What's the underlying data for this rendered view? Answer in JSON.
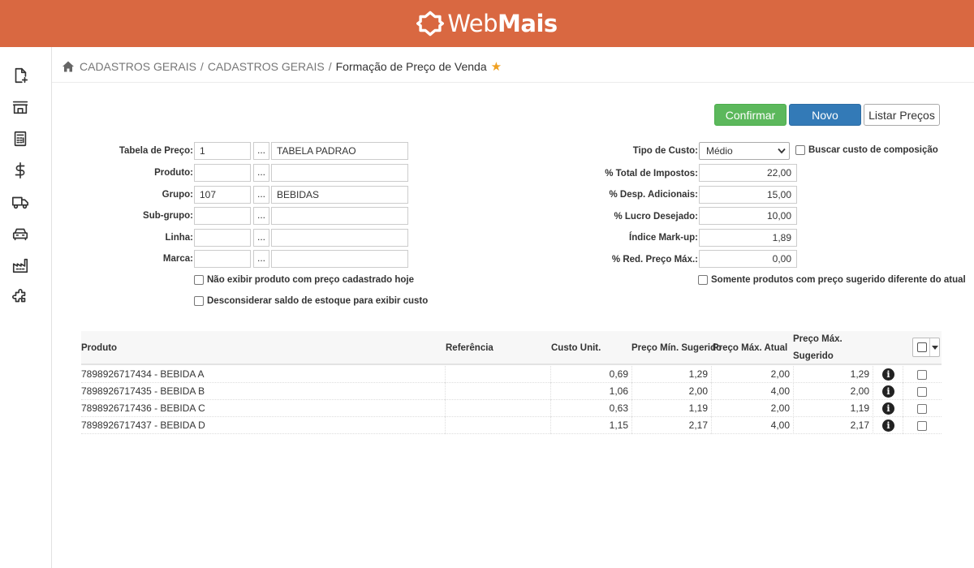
{
  "app": {
    "logo_light": "Web",
    "logo_bold": "Mais"
  },
  "breadcrumb": {
    "items": [
      "CADASTROS GERAIS",
      "CADASTROS GERAIS"
    ],
    "separator": "/",
    "current": "Formação de Preço de Venda",
    "star": "★"
  },
  "sidebar": {
    "icons": [
      "file-plus-icon",
      "store-icon",
      "calculator-icon",
      "dollar-icon",
      "truck-icon",
      "car-icon",
      "factory-icon",
      "puzzle-icon"
    ]
  },
  "buttons": {
    "confirm": "Confirmar",
    "novo": "Novo",
    "listar": "Listar Preços"
  },
  "colors": {
    "topbar": "#d96841",
    "confirm": "#5cb85c",
    "novo": "#337ab7",
    "star": "#f0a020"
  },
  "form": {
    "tabela_preco": {
      "label": "Tabela de Preço:",
      "code": "1",
      "dots": "...",
      "name": "TABELA PADRAO"
    },
    "produto": {
      "label": "Produto:",
      "code": "",
      "dots": "...",
      "name": ""
    },
    "grupo": {
      "label": "Grupo:",
      "code": "107",
      "dots": "...",
      "name": "BEBIDAS"
    },
    "subgrupo": {
      "label": "Sub-grupo:",
      "code": "",
      "dots": "...",
      "name": ""
    },
    "linha": {
      "label": "Linha:",
      "code": "",
      "dots": "...",
      "name": ""
    },
    "marca": {
      "label": "Marca:",
      "code": "",
      "dots": "...",
      "name": ""
    },
    "check_nao_exibir": {
      "label": "Não exibir produto com preço cadastrado hoje",
      "checked": false
    },
    "check_desconsiderar": {
      "label": "Desconsiderar saldo de estoque para exibir custo",
      "checked": false
    },
    "tipo_custo": {
      "label": "Tipo de Custo:",
      "value": "Médio"
    },
    "check_buscar": {
      "label": "Buscar custo de composição",
      "checked": false
    },
    "total_impostos": {
      "label": "% Total de Impostos:",
      "value": "22,00"
    },
    "desp_adicionais": {
      "label": "% Desp. Adicionais:",
      "value": "15,00"
    },
    "lucro_desejado": {
      "label": "% Lucro Desejado:",
      "value": "10,00"
    },
    "markup": {
      "label": "Índice Mark-up:",
      "value": "1,89"
    },
    "red_preco_max": {
      "label": "% Red. Preço Máx.:",
      "value": "0,00"
    },
    "check_somente": {
      "label": "Somente produtos com preço sugerido diferente do atual",
      "checked": false
    }
  },
  "table": {
    "headers": {
      "produto": "Produto",
      "referencia": "Referência",
      "custo": "Custo Unit.",
      "min_sugerido": "Preço Mín. Sugerido",
      "max_atual": "Preço Máx. Atual",
      "max_sugerido_1": "Preço Máx.",
      "max_sugerido_2": "Sugerido"
    },
    "rows": [
      {
        "produto": "7898926717434 - BEBIDA A",
        "referencia": "",
        "custo": "0,69",
        "min_sugerido": "1,29",
        "max_atual": "2,00",
        "max_sugerido": "1,29"
      },
      {
        "produto": "7898926717435 - BEBIDA B",
        "referencia": "",
        "custo": "1,06",
        "min_sugerido": "2,00",
        "max_atual": "4,00",
        "max_sugerido": "2,00"
      },
      {
        "produto": "7898926717436 - BEBIDA C",
        "referencia": "",
        "custo": "0,63",
        "min_sugerido": "1,19",
        "max_atual": "2,00",
        "max_sugerido": "1,19"
      },
      {
        "produto": "7898926717437 - BEBIDA D",
        "referencia": "",
        "custo": "1,15",
        "min_sugerido": "2,17",
        "max_atual": "4,00",
        "max_sugerido": "2,17"
      }
    ],
    "info_icon": "i"
  }
}
